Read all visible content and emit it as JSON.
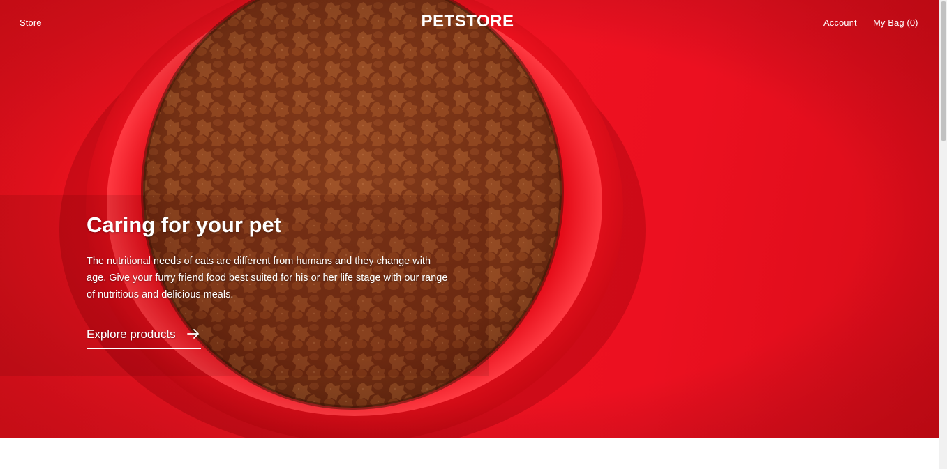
{
  "header": {
    "store_label": "Store",
    "brand": "PETSTORE",
    "account_label": "Account",
    "bag_label": "My Bag (0)"
  },
  "hero": {
    "title": "Caring for your pet",
    "description": "The nutritional needs of cats are different from humans and they change with age. Give your furry friend food best suited for his or her life stage with our range of nutritious and delicious meals.",
    "cta_label": "Explore products",
    "cta_icon": "arrow-right-icon",
    "image": "red-bowl-of-kibble"
  },
  "colors": {
    "hero_red": "#ec1020",
    "text": "#ffffff",
    "page_bg": "#ffffff"
  }
}
